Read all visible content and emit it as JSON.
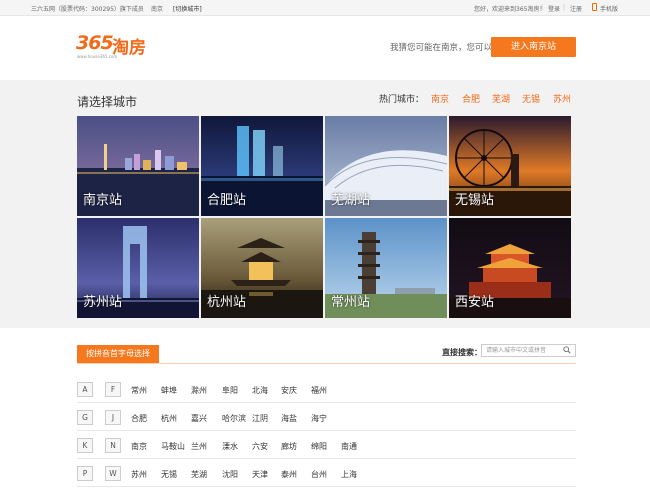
{
  "topbar": {
    "site": "三六五网（股票代码：300295）旗下成员",
    "city": "南京",
    "switch": "[切换城市]",
    "welcome": "您好，欢迎来到365淘房！",
    "login": "登录",
    "register": "注册",
    "mobile": "手机版"
  },
  "header": {
    "logo_num": "365",
    "logo_text": "淘房",
    "logo_url": "www.house365.com",
    "guess": "我猜您可能在南京，您可以",
    "enter_button": "进入南京站"
  },
  "city_zone": {
    "title": "请选择城市",
    "hot_label": "热门城市：",
    "hot_cities": [
      "南京",
      "合肥",
      "芜湖",
      "无锡",
      "苏州"
    ],
    "tiles": [
      {
        "label": "南京站",
        "scene": "nanjing-night-skyline"
      },
      {
        "label": "合肥站",
        "scene": "hefei-twin-towers"
      },
      {
        "label": "芜湖站",
        "scene": "wuhu-modern-building"
      },
      {
        "label": "无锡站",
        "scene": "wuxi-ferris-wheel"
      },
      {
        "label": "苏州站",
        "scene": "suzhou-gate-tower"
      },
      {
        "label": "杭州站",
        "scene": "hangzhou-pavilion"
      },
      {
        "label": "常州站",
        "scene": "changzhou-pagoda"
      },
      {
        "label": "西安站",
        "scene": "xian-bell-tower"
      }
    ]
  },
  "alpha": {
    "tab_label": "按拼音首字母选择",
    "direct_search_label": "直接搜索：",
    "search_placeholder": "请输入城市中文或拼音",
    "rows": [
      {
        "letters": [
          "A",
          "F"
        ],
        "cities": [
          "常州",
          "蚌埠",
          "滁州",
          "阜阳",
          "北海",
          "安庆",
          "福州"
        ]
      },
      {
        "letters": [
          "G",
          "J"
        ],
        "cities": [
          "合肥",
          "杭州",
          "嘉兴",
          "哈尔滨",
          "江阴",
          "海盐",
          "海宁"
        ]
      },
      {
        "letters": [
          "K",
          "N"
        ],
        "cities": [
          "南京",
          "马鞍山",
          "兰州",
          "溧水",
          "六安",
          "廊坊",
          "绵阳",
          "南通"
        ]
      },
      {
        "letters": [
          "P",
          "W"
        ],
        "cities": [
          "苏州",
          "无锡",
          "芜湖",
          "沈阳",
          "天津",
          "泰州",
          "台州",
          "上海"
        ]
      }
    ]
  },
  "colors": {
    "accent": "#f5781e",
    "zone_bg": "#f2f2f2"
  }
}
